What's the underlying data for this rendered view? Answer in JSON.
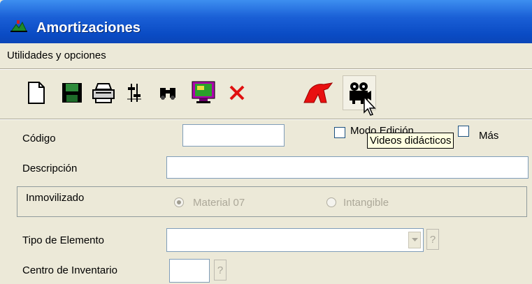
{
  "window": {
    "title": "Amortizaciones"
  },
  "menu": {
    "items": [
      {
        "label": "Utilidades y opciones"
      }
    ]
  },
  "toolbar": {
    "buttons": [
      {
        "icon": "new-document-icon"
      },
      {
        "icon": "save-icon"
      },
      {
        "icon": "print-icon"
      },
      {
        "icon": "settings-sliders-icon"
      },
      {
        "icon": "binoculars-search-icon"
      },
      {
        "icon": "monitor-preview-icon"
      },
      {
        "icon": "delete-x-icon"
      },
      {
        "icon": "exit-icon"
      },
      {
        "icon": "video-camera-icon"
      }
    ],
    "tooltip": "Videos didácticos"
  },
  "form": {
    "codigo": {
      "label": "Código",
      "value": ""
    },
    "modo_edicion": {
      "label": "Modo Edición",
      "checked": false
    },
    "mas": {
      "label": "Más",
      "checked": false
    },
    "descripcion": {
      "label": "Descripción",
      "value": ""
    },
    "inmovilizado": {
      "label": "Inmovilizado",
      "options": [
        {
          "label": "Material 07",
          "selected": true
        },
        {
          "label": "Intangible",
          "selected": false
        }
      ]
    },
    "tipo_elemento": {
      "label": "Tipo de Elemento",
      "value": "",
      "help": "?"
    },
    "centro_inventario": {
      "label": "Centro de Inventario",
      "value": "",
      "help": "?"
    }
  },
  "colors": {
    "titlebar": "#0a4bc4",
    "face": "#ece9d8",
    "tooltip_bg": "#ffffe1"
  }
}
